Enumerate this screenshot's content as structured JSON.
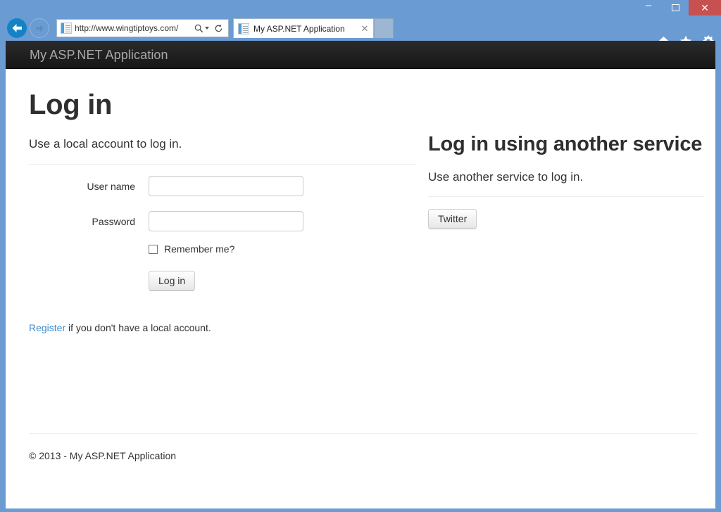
{
  "browser": {
    "window_controls": {
      "minimize_label": "–",
      "maximize_label": "",
      "close_label": "✕"
    },
    "back_button_label": "Back",
    "forward_button_label": "Forward",
    "address": {
      "url": "http://www.wingtiptoys.com/",
      "favicon": "page-icon",
      "search_icon": "search-icon",
      "refresh_icon": "refresh-icon"
    },
    "tabs": [
      {
        "title": "My ASP.NET Application",
        "favicon": "page-icon",
        "close_label": "✕",
        "active": true
      }
    ],
    "new_tab_label": "",
    "toolbar_icons": [
      {
        "name": "home-icon"
      },
      {
        "name": "favorites-star-icon"
      },
      {
        "name": "settings-gear-icon"
      }
    ],
    "chrome_color": "#6a9bd3",
    "close_button_color": "#c75050"
  },
  "page": {
    "navbar": {
      "brand": "My ASP.NET Application",
      "background_top": "#2b2b2b",
      "background_bottom": "#161616",
      "brand_color": "#a8a8a8"
    },
    "title": "Log in",
    "left_column": {
      "lead": "Use a local account to log in.",
      "form": {
        "fields": [
          {
            "label": "User name",
            "value": "",
            "placeholder": "",
            "type": "text"
          },
          {
            "label": "Password",
            "value": "",
            "placeholder": "",
            "type": "password"
          }
        ],
        "remember_me": {
          "label": "Remember me?",
          "checked": false
        },
        "submit_label": "Log in"
      },
      "register_link_text": "Register",
      "register_rest_text": " if you don't have a local account."
    },
    "right_column": {
      "heading": "Log in using another service",
      "lead": "Use another service to log in.",
      "providers": [
        {
          "label": "Twitter"
        }
      ]
    },
    "footer": "© 2013 - My ASP.NET Application",
    "link_color": "#428bca"
  }
}
